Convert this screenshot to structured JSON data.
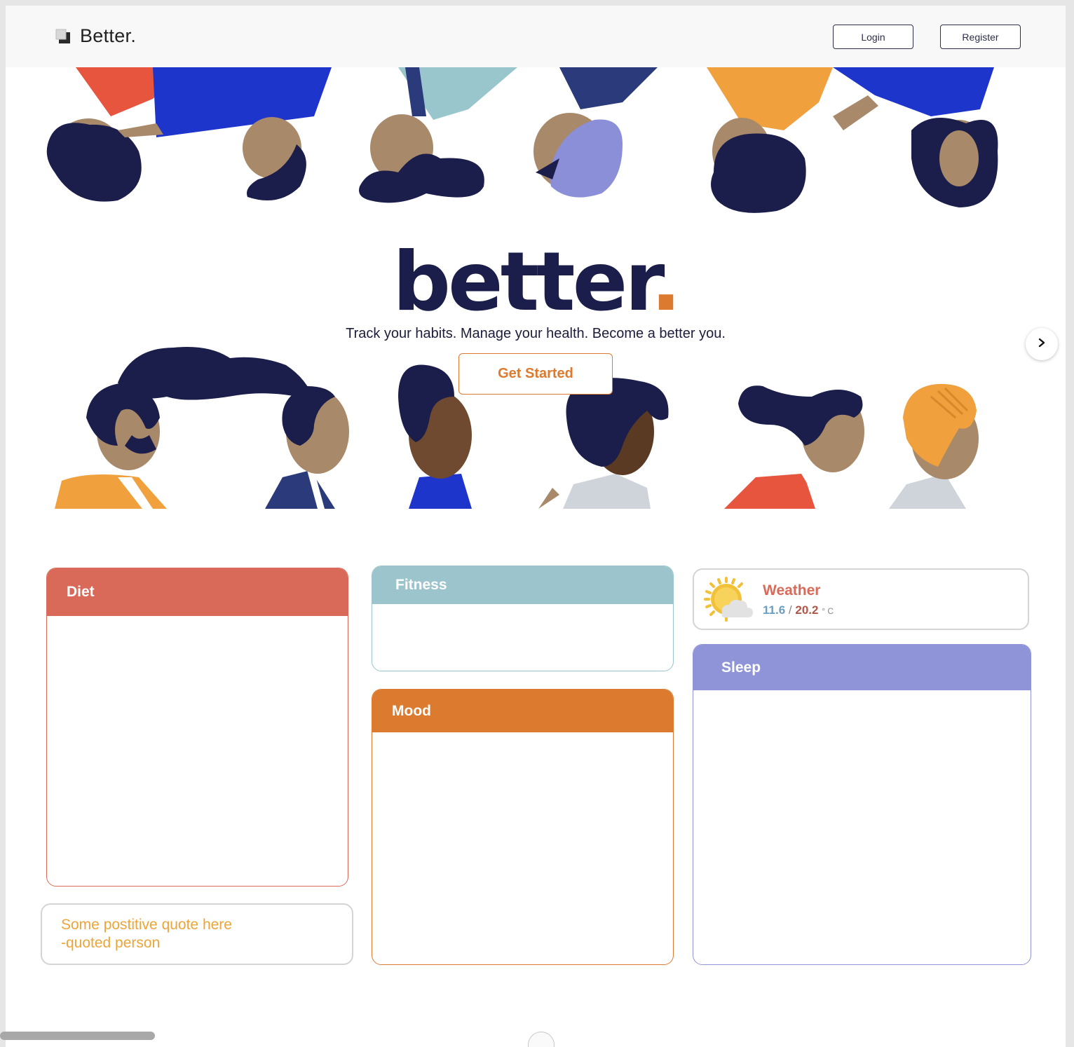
{
  "navbar": {
    "brand": "Better.",
    "login_label": "Login",
    "register_label": "Register"
  },
  "hero": {
    "title": "better",
    "title_dot": ".",
    "tagline": "Track your habits. Manage your health. Become a better you.",
    "cta_label": "Get Started"
  },
  "cards": {
    "diet": {
      "title": "Diet"
    },
    "fitness": {
      "title": "Fitness"
    },
    "mood": {
      "title": "Mood"
    },
    "sleep": {
      "title": "Sleep"
    }
  },
  "weather": {
    "title": "Weather",
    "low": "11.6",
    "separator": "/",
    "high": "20.2",
    "unit": "° C"
  },
  "quote": {
    "text": "Some postitive quote here",
    "author": "-quoted person"
  },
  "colors": {
    "navy": "#1b1d4a",
    "orange": "#dc7a30",
    "diet": "#d96a5a",
    "fitness": "#9bc4cd",
    "sleep": "#8f94d8",
    "quote_text": "#eda43a"
  },
  "icons": {
    "brand": "cube-logo-icon",
    "carousel": "chevron-right-icon",
    "weather": "sun-cloud-icon"
  }
}
